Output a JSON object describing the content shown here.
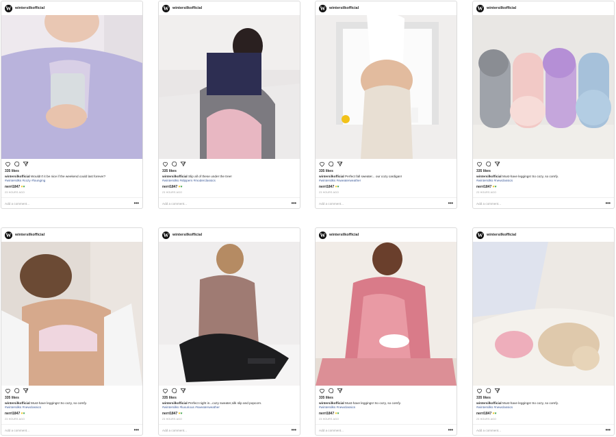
{
  "brand": {
    "username": "wintersilkofficial",
    "logo_letter": "W"
  },
  "common": {
    "likes": "335 likes",
    "commenter": "nerri1847",
    "time": "23 HOURS AGO",
    "add_comment": "Add a comment...",
    "more": "•••"
  },
  "colors": {
    "link": "#3b5998",
    "border": "#dbdbdb"
  },
  "icons": [
    "heart-icon",
    "comment-icon",
    "share-icon",
    "more-icon",
    "yellow-heart-icon",
    "green-heart-icon"
  ],
  "posts": [
    {
      "caption": "Wouldn't it be nice if the weekend could last forever?",
      "tags": "#wintersilks #cozy #lounging",
      "photo": "woman in lavender cardigan holding mug"
    },
    {
      "caption": "Slip all of these under the tree!",
      "tags": "#wintersilks #slippers #moderclassics",
      "photo": "woman reading notebook in bed"
    },
    {
      "caption": "Perfect fall sweater... our cozy cardigan!",
      "tags": "#wintersilks #sweaterweather",
      "photo": "woman in silk slip with towel"
    },
    {
      "caption": "Must-have leggings! So cozy, so comfy.",
      "tags": "#wintersilks #newclassics",
      "photo": "row of fuzzy slippers"
    },
    {
      "caption": "Must-have leggings! So cozy, so comfy.",
      "tags": "#wintersilks #newclassics",
      "photo": "woman in white bra and open shirt"
    },
    {
      "caption": "Perfect night in...cozy sweater,silk slip and popcorn.",
      "tags": "#wintersilks #luxurious #sweaterweather",
      "photo": "woman sitting cross-legged with tablet"
    },
    {
      "caption": "Must-have leggings! So cozy, so comfy.",
      "tags": "#wintersilks #newclassics",
      "photo": "woman in paisley pajamas with bowl"
    },
    {
      "caption": "Must-have leggings! So cozy, so comfy.",
      "tags": "#wintersilks #newclassics",
      "photo": "french bulldog on cozy blanket"
    }
  ]
}
